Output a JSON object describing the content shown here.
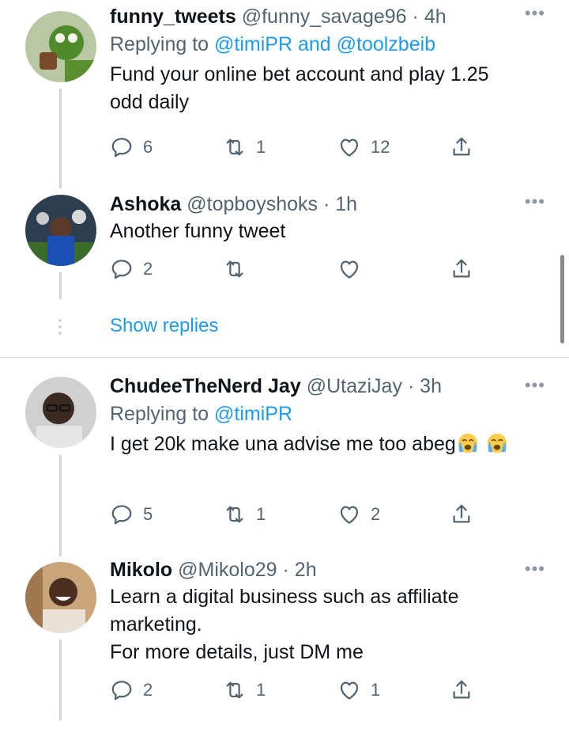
{
  "tweets": [
    {
      "name": "funny_tweets",
      "handle": "@funny_savage96",
      "time": "· 4h",
      "replying_label": "Replying to",
      "replying_to": "@timiPR and @toolzbeib",
      "text": "Fund your online bet account and play 1.25\nodd daily",
      "replies": "6",
      "retweets": "1",
      "likes": "12"
    },
    {
      "name": "Ashoka",
      "handle": "@topboyshoks",
      "time": "· 1h",
      "text": "Another funny tweet",
      "replies": "2",
      "retweets": "",
      "likes": ""
    },
    {
      "name": "ChudeeTheNerd Jay",
      "handle": "@UtaziJay",
      "time": "· 3h",
      "replying_label": "Replying to",
      "replying_to": "@timiPR",
      "text": "I get 20k make una advise me too abeg",
      "replies": "5",
      "retweets": "1",
      "likes": "2"
    },
    {
      "name": "Mikolo",
      "handle": "@Mikolo29",
      "time": "· 2h",
      "text": "Learn a digital business such as affiliate\nmarketing.\nFor more details, just DM me",
      "replies": "2",
      "retweets": "1",
      "likes": "1"
    }
  ],
  "show_replies": "Show replies",
  "icons": {
    "reply": "reply-icon",
    "retweet": "retweet-icon",
    "like": "heart-icon",
    "share": "share-icon",
    "more": "more-options-icon",
    "emoji": "loudly-crying-face-emoji"
  },
  "colors": {
    "link": "#1d9bf0",
    "muted": "#536471",
    "thread": "#cfd9de"
  }
}
